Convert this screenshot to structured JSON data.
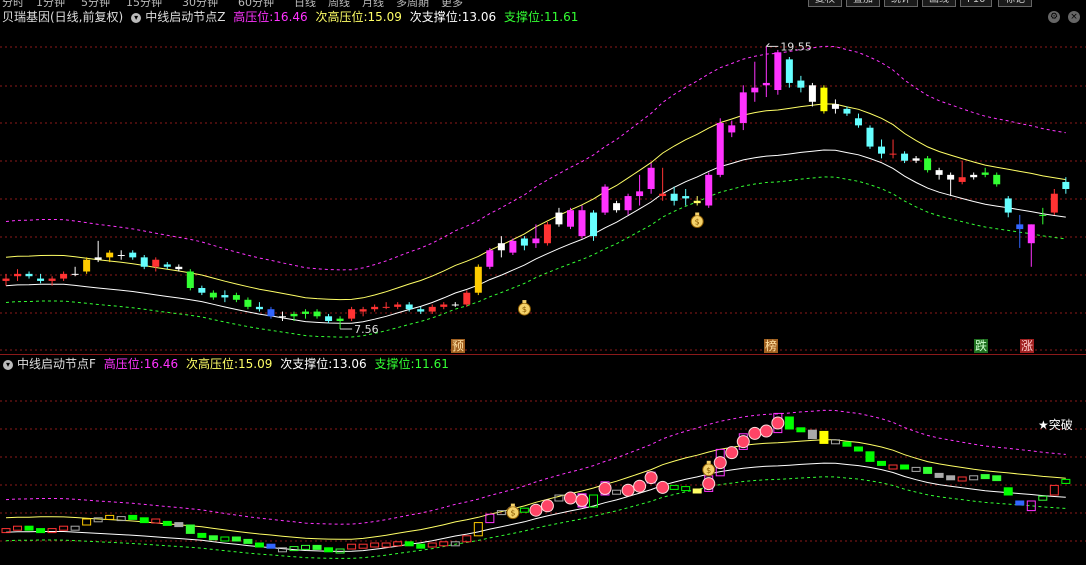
{
  "toolbar": {
    "tabs": [
      "分时",
      "1分钟",
      "5分钟",
      "15分钟",
      "30分钟",
      "60分钟",
      "日线",
      "周线",
      "月线",
      "多周期",
      "更多"
    ],
    "buttons": [
      "复权",
      "叠加",
      "统计",
      "画线",
      "F10",
      "标记"
    ]
  },
  "panel1": {
    "stock_name": "贝瑞基因(日线,前复权)",
    "indicator": "中线启动节点Z",
    "high_label": "高压位:",
    "high_value": "16.46",
    "sub_high_label": "次高压位:",
    "sub_high_value": "15.09",
    "sub_support_label": "次支撑位:",
    "sub_support_value": "13.06",
    "support_label": "支撑位:",
    "support_value": "11.61",
    "max_label": "19.55",
    "min_label": "7.56",
    "marker_yu": "预",
    "marker_bang": "榜",
    "marker_die": "跌",
    "marker_zhang": "涨"
  },
  "panel2": {
    "indicator": "中线启动节点F",
    "high_label": "高压位:",
    "high_value": "16.46",
    "sub_high_label": "次高压位:",
    "sub_high_value": "15.09",
    "sub_support_label": "次支撑位:",
    "sub_support_value": "13.06",
    "support_label": "支撑位:",
    "support_value": "11.61",
    "breakout_label": "★突破"
  },
  "colors": {
    "high": "#ff33ff",
    "sub_high": "#ffff66",
    "sub_support": "#ffffff",
    "support": "#33ff33",
    "grid": "#8b1a1a"
  },
  "chart_data": {
    "type": "candlestick",
    "y_range": [
      6.5,
      20.5
    ],
    "candles": [
      {
        "o": 9.6,
        "h": 9.9,
        "l": 9.4,
        "c": 9.7,
        "col": "#ff3333"
      },
      {
        "o": 9.8,
        "h": 10.1,
        "l": 9.6,
        "c": 9.9,
        "col": "#ff3333"
      },
      {
        "o": 9.9,
        "h": 10.0,
        "l": 9.7,
        "c": 9.8,
        "col": "#66ffff"
      },
      {
        "o": 9.7,
        "h": 9.9,
        "l": 9.5,
        "c": 9.6,
        "col": "#66ffff"
      },
      {
        "o": 9.6,
        "h": 9.8,
        "l": 9.4,
        "c": 9.7,
        "col": "#ff3333"
      },
      {
        "o": 9.7,
        "h": 10.0,
        "l": 9.6,
        "c": 9.9,
        "col": "#ff3333"
      },
      {
        "o": 9.9,
        "h": 10.2,
        "l": 9.8,
        "c": 9.9,
        "col": "#ffffff"
      },
      {
        "o": 10.0,
        "h": 10.6,
        "l": 9.9,
        "c": 10.5,
        "col": "#ffcc00"
      },
      {
        "o": 10.5,
        "h": 11.3,
        "l": 10.4,
        "c": 10.6,
        "col": "#ffffff"
      },
      {
        "o": 10.6,
        "h": 10.9,
        "l": 10.4,
        "c": 10.8,
        "col": "#ffcc00"
      },
      {
        "o": 10.7,
        "h": 10.9,
        "l": 10.5,
        "c": 10.7,
        "col": "#ffffff"
      },
      {
        "o": 10.8,
        "h": 10.9,
        "l": 10.5,
        "c": 10.6,
        "col": "#66ffff"
      },
      {
        "o": 10.6,
        "h": 10.7,
        "l": 10.1,
        "c": 10.2,
        "col": "#66ffff"
      },
      {
        "o": 10.2,
        "h": 10.6,
        "l": 10.0,
        "c": 10.5,
        "col": "#ff3333"
      },
      {
        "o": 10.3,
        "h": 10.4,
        "l": 10.1,
        "c": 10.2,
        "col": "#66ffff"
      },
      {
        "o": 10.2,
        "h": 10.3,
        "l": 10.0,
        "c": 10.1,
        "col": "#ffffff"
      },
      {
        "o": 10.0,
        "h": 10.1,
        "l": 9.2,
        "c": 9.3,
        "col": "#33ff33"
      },
      {
        "o": 9.3,
        "h": 9.4,
        "l": 9.0,
        "c": 9.1,
        "col": "#66ffff"
      },
      {
        "o": 9.1,
        "h": 9.2,
        "l": 8.8,
        "c": 8.9,
        "col": "#33ff33"
      },
      {
        "o": 8.9,
        "h": 9.2,
        "l": 8.7,
        "c": 9.0,
        "col": "#66ffff"
      },
      {
        "o": 9.0,
        "h": 9.1,
        "l": 8.7,
        "c": 8.8,
        "col": "#33ff33"
      },
      {
        "o": 8.8,
        "h": 8.9,
        "l": 8.4,
        "c": 8.5,
        "col": "#33ff33"
      },
      {
        "o": 8.5,
        "h": 8.7,
        "l": 8.3,
        "c": 8.4,
        "col": "#66ffff"
      },
      {
        "o": 8.4,
        "h": 8.5,
        "l": 8.0,
        "c": 8.1,
        "col": "#3366ff"
      },
      {
        "o": 8.1,
        "h": 8.3,
        "l": 7.9,
        "c": 8.1,
        "col": "#ffffff"
      },
      {
        "o": 8.1,
        "h": 8.3,
        "l": 7.9,
        "c": 8.2,
        "col": "#33ff33"
      },
      {
        "o": 8.2,
        "h": 8.4,
        "l": 8.0,
        "c": 8.3,
        "col": "#33ff33"
      },
      {
        "o": 8.3,
        "h": 8.4,
        "l": 8.0,
        "c": 8.1,
        "col": "#33ff33"
      },
      {
        "o": 8.1,
        "h": 8.2,
        "l": 7.8,
        "c": 7.9,
        "col": "#66ffff"
      },
      {
        "o": 7.9,
        "h": 8.1,
        "l": 7.56,
        "c": 8.0,
        "col": "#33ff33"
      },
      {
        "o": 8.0,
        "h": 8.5,
        "l": 7.9,
        "c": 8.4,
        "col": "#ff3333"
      },
      {
        "o": 8.3,
        "h": 8.5,
        "l": 8.1,
        "c": 8.4,
        "col": "#ff3333"
      },
      {
        "o": 8.4,
        "h": 8.6,
        "l": 8.3,
        "c": 8.5,
        "col": "#ff3333"
      },
      {
        "o": 8.5,
        "h": 8.7,
        "l": 8.4,
        "c": 8.5,
        "col": "#ff3333"
      },
      {
        "o": 8.5,
        "h": 8.7,
        "l": 8.4,
        "c": 8.6,
        "col": "#ff3333"
      },
      {
        "o": 8.6,
        "h": 8.7,
        "l": 8.3,
        "c": 8.4,
        "col": "#66ffff"
      },
      {
        "o": 8.4,
        "h": 8.5,
        "l": 8.2,
        "c": 8.3,
        "col": "#66ffff"
      },
      {
        "o": 8.3,
        "h": 8.6,
        "l": 8.2,
        "c": 8.5,
        "col": "#ff3333"
      },
      {
        "o": 8.5,
        "h": 8.7,
        "l": 8.4,
        "c": 8.6,
        "col": "#ff3333"
      },
      {
        "o": 8.6,
        "h": 8.7,
        "l": 8.5,
        "c": 8.6,
        "col": "#ffffff"
      },
      {
        "o": 8.6,
        "h": 9.2,
        "l": 8.5,
        "c": 9.1,
        "col": "#ff3333"
      },
      {
        "o": 9.1,
        "h": 10.3,
        "l": 9.0,
        "c": 10.2,
        "col": "#ffcc00"
      },
      {
        "o": 10.2,
        "h": 11.0,
        "l": 10.1,
        "c": 10.9,
        "col": "#ff33ff"
      },
      {
        "o": 10.9,
        "h": 11.5,
        "l": 10.6,
        "c": 11.2,
        "col": "#ffffff"
      },
      {
        "o": 10.8,
        "h": 11.4,
        "l": 10.7,
        "c": 11.3,
        "col": "#ff33ff"
      },
      {
        "o": 11.1,
        "h": 11.5,
        "l": 10.9,
        "c": 11.4,
        "col": "#66ffff"
      },
      {
        "o": 11.4,
        "h": 12.0,
        "l": 11.0,
        "c": 11.2,
        "col": "#ff33ff"
      },
      {
        "o": 11.2,
        "h": 12.1,
        "l": 11.1,
        "c": 12.0,
        "col": "#ff3333"
      },
      {
        "o": 12.0,
        "h": 12.7,
        "l": 11.9,
        "c": 12.5,
        "col": "#ffffff"
      },
      {
        "o": 11.9,
        "h": 12.7,
        "l": 11.8,
        "c": 12.6,
        "col": "#ff33ff"
      },
      {
        "o": 12.6,
        "h": 12.8,
        "l": 11.4,
        "c": 11.5,
        "col": "#ff33ff"
      },
      {
        "o": 11.5,
        "h": 12.6,
        "l": 11.3,
        "c": 12.5,
        "col": "#66ffff"
      },
      {
        "o": 12.5,
        "h": 13.7,
        "l": 12.4,
        "c": 13.6,
        "col": "#ff33ff"
      },
      {
        "o": 12.6,
        "h": 13.0,
        "l": 12.5,
        "c": 12.9,
        "col": "#ffffff"
      },
      {
        "o": 12.6,
        "h": 13.3,
        "l": 12.4,
        "c": 13.2,
        "col": "#ff33ff"
      },
      {
        "o": 13.2,
        "h": 14.1,
        "l": 12.8,
        "c": 13.4,
        "col": "#ff33ff"
      },
      {
        "o": 13.5,
        "h": 14.6,
        "l": 13.3,
        "c": 14.4,
        "col": "#ff33ff"
      },
      {
        "o": 13.2,
        "h": 14.4,
        "l": 13.0,
        "c": 13.3,
        "col": "#ff3333"
      },
      {
        "o": 13.0,
        "h": 13.6,
        "l": 12.8,
        "c": 13.3,
        "col": "#66ffff"
      },
      {
        "o": 13.1,
        "h": 13.5,
        "l": 12.8,
        "c": 13.2,
        "col": "#66ffff"
      },
      {
        "o": 13.0,
        "h": 13.2,
        "l": 12.8,
        "c": 12.9,
        "col": "#ffff66"
      },
      {
        "o": 12.8,
        "h": 14.2,
        "l": 12.7,
        "c": 14.1,
        "col": "#ff33ff"
      },
      {
        "o": 14.1,
        "h": 16.5,
        "l": 14.0,
        "c": 16.3,
        "col": "#ff33ff"
      },
      {
        "o": 15.9,
        "h": 16.4,
        "l": 15.7,
        "c": 16.2,
        "col": "#ff33ff"
      },
      {
        "o": 16.3,
        "h": 17.9,
        "l": 16.0,
        "c": 17.6,
        "col": "#ff33ff"
      },
      {
        "o": 17.6,
        "h": 18.9,
        "l": 17.2,
        "c": 17.8,
        "col": "#ff33ff"
      },
      {
        "o": 18.0,
        "h": 19.55,
        "l": 17.4,
        "c": 17.9,
        "col": "#ff33ff"
      },
      {
        "o": 17.7,
        "h": 19.4,
        "l": 17.5,
        "c": 19.3,
        "col": "#ff33ff"
      },
      {
        "o": 19.0,
        "h": 19.1,
        "l": 17.8,
        "c": 18.0,
        "col": "#66ffff"
      },
      {
        "o": 18.1,
        "h": 18.3,
        "l": 17.6,
        "c": 17.8,
        "col": "#66ffff"
      },
      {
        "o": 17.9,
        "h": 18.0,
        "l": 17.0,
        "c": 17.2,
        "col": "#ffffff"
      },
      {
        "o": 17.8,
        "h": 17.9,
        "l": 16.7,
        "c": 16.8,
        "col": "#ffff00"
      },
      {
        "o": 16.9,
        "h": 17.3,
        "l": 16.7,
        "c": 17.1,
        "col": "#ffffff"
      },
      {
        "o": 16.9,
        "h": 17.0,
        "l": 16.6,
        "c": 16.7,
        "col": "#66ffff"
      },
      {
        "o": 16.5,
        "h": 16.7,
        "l": 16.1,
        "c": 16.2,
        "col": "#66ffff"
      },
      {
        "o": 16.1,
        "h": 16.2,
        "l": 15.2,
        "c": 15.3,
        "col": "#66ffff"
      },
      {
        "o": 15.3,
        "h": 15.6,
        "l": 14.8,
        "c": 15.0,
        "col": "#66ffff"
      },
      {
        "o": 15.0,
        "h": 15.6,
        "l": 14.8,
        "c": 15.0,
        "col": "#ff3333"
      },
      {
        "o": 15.0,
        "h": 15.1,
        "l": 14.6,
        "c": 14.7,
        "col": "#66ffff"
      },
      {
        "o": 14.7,
        "h": 14.9,
        "l": 14.6,
        "c": 14.8,
        "col": "#ffffff"
      },
      {
        "o": 14.8,
        "h": 14.9,
        "l": 14.2,
        "c": 14.3,
        "col": "#33ff33"
      },
      {
        "o": 14.3,
        "h": 14.4,
        "l": 13.9,
        "c": 14.1,
        "col": "#ffffff"
      },
      {
        "o": 14.1,
        "h": 14.2,
        "l": 13.2,
        "c": 13.9,
        "col": "#ffffff"
      },
      {
        "o": 13.8,
        "h": 14.7,
        "l": 13.7,
        "c": 14.0,
        "col": "#ff3333"
      },
      {
        "o": 14.0,
        "h": 14.2,
        "l": 13.9,
        "c": 14.1,
        "col": "#ffffff"
      },
      {
        "o": 14.2,
        "h": 14.4,
        "l": 14.0,
        "c": 14.1,
        "col": "#33ff33"
      },
      {
        "o": 14.1,
        "h": 14.2,
        "l": 13.6,
        "c": 13.7,
        "col": "#33ff33"
      },
      {
        "o": 13.1,
        "h": 13.2,
        "l": 12.3,
        "c": 12.5,
        "col": "#66ffff"
      },
      {
        "o": 12.0,
        "h": 12.4,
        "l": 11.0,
        "c": 11.8,
        "col": "#3366ff"
      },
      {
        "o": 11.2,
        "h": 12.0,
        "l": 10.2,
        "c": 12.0,
        "col": "#ff33ff"
      },
      {
        "o": 12.4,
        "h": 12.7,
        "l": 12.0,
        "c": 12.4,
        "col": "#33ff33"
      },
      {
        "o": 12.5,
        "h": 13.5,
        "l": 12.4,
        "c": 13.3,
        "col": "#ff3333"
      },
      {
        "o": 13.5,
        "h": 14.0,
        "l": 13.3,
        "c": 13.8,
        "col": "#66ffff"
      }
    ]
  }
}
